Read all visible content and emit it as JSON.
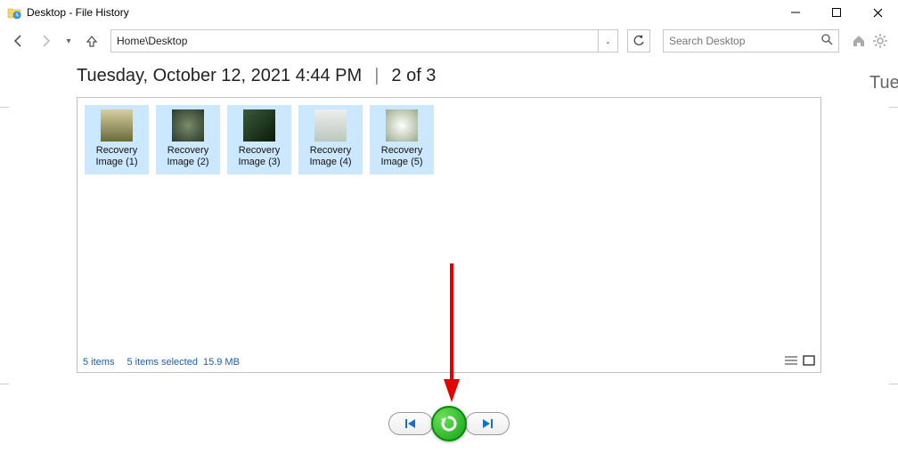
{
  "window": {
    "title": "Desktop - File History"
  },
  "nav": {
    "path": "Home\\Desktop",
    "search_placeholder": "Search Desktop"
  },
  "version": {
    "datetime": "Tuesday, October 12, 2021 4:44 PM",
    "position": "2 of 3",
    "next_preview_title": "Tuesda"
  },
  "items": [
    {
      "name_l1": "Recovery",
      "name_l2": "Image (1)"
    },
    {
      "name_l1": "Recovery",
      "name_l2": "Image (2)"
    },
    {
      "name_l1": "Recovery",
      "name_l2": "Image (3)"
    },
    {
      "name_l1": "Recovery",
      "name_l2": "Image (4)"
    },
    {
      "name_l1": "Recovery",
      "name_l2": "Image (5)"
    }
  ],
  "status": {
    "count": "5 items",
    "selection": "5 items selected",
    "size": "15.9 MB"
  }
}
